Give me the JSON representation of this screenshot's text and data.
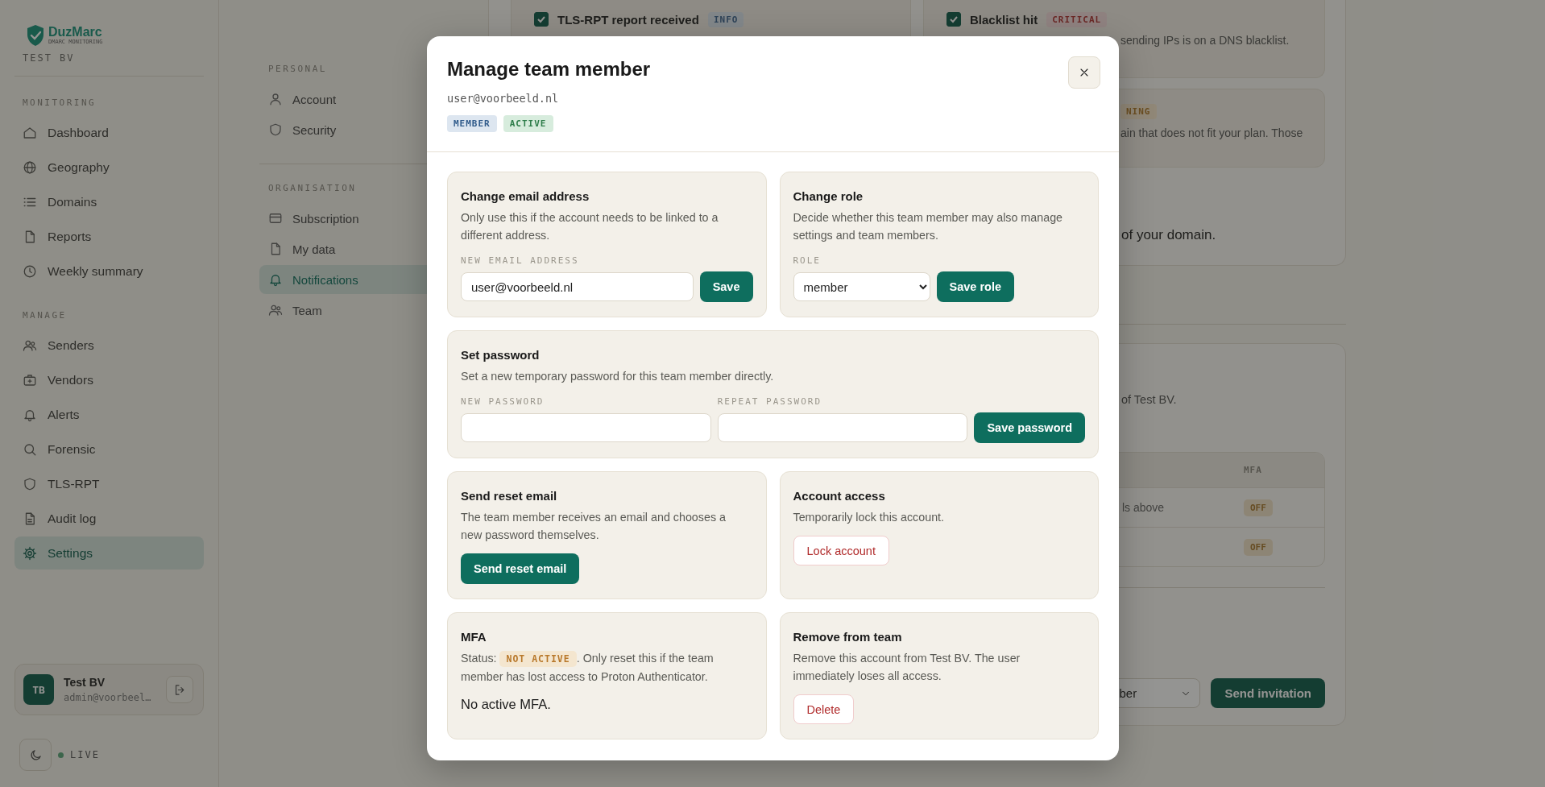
{
  "sidebar": {
    "logo": {
      "name": "DuzMarc",
      "tagline": "DMARC MONITORING"
    },
    "organisation": "TEST BV",
    "sections": [
      {
        "title": "MONITORING",
        "items": [
          {
            "label": "Dashboard",
            "selected": false
          },
          {
            "label": "Geography",
            "selected": false
          },
          {
            "label": "Domains",
            "selected": false
          },
          {
            "label": "Reports",
            "selected": false
          },
          {
            "label": "Weekly summary",
            "selected": false
          }
        ]
      },
      {
        "title": "MANAGE",
        "items": [
          {
            "label": "Senders",
            "selected": false
          },
          {
            "label": "Vendors",
            "selected": false
          },
          {
            "label": "Alerts",
            "selected": false
          },
          {
            "label": "Forensic",
            "selected": false
          },
          {
            "label": "TLS-RPT",
            "selected": false
          },
          {
            "label": "Audit log",
            "selected": false
          },
          {
            "label": "Settings",
            "selected": true
          }
        ]
      }
    ],
    "user": {
      "initials": "TB",
      "name": "Test BV",
      "email": "admin@voorbeel…"
    },
    "status": "LIVE"
  },
  "settings_nav": {
    "sections": [
      {
        "title": "PERSONAL",
        "items": [
          {
            "label": "Account",
            "selected": false
          },
          {
            "label": "Security",
            "selected": false
          }
        ]
      },
      {
        "title": "ORGANISATION",
        "items": [
          {
            "label": "Subscription",
            "selected": false
          },
          {
            "label": "My data",
            "selected": false
          },
          {
            "label": "Notifications",
            "selected": true
          },
          {
            "label": "Team",
            "selected": false
          }
        ]
      }
    ]
  },
  "notifications": {
    "cards": [
      {
        "title": "TLS-RPT report received",
        "checked": true,
        "badge": "INFO",
        "kind": "info"
      },
      {
        "title": "Blacklist hit",
        "checked": true,
        "badge": "CRITICAL",
        "kind": "critical",
        "description": "sending IPs is on a DNS blacklist."
      },
      {
        "badge": "NING",
        "kind": "warning",
        "description": "ain that does not fit your plan. Those"
      }
    ],
    "note": "of your domain."
  },
  "team": {
    "description": "of Test BV.",
    "table": {
      "columns": [
        {
          "label": "MFA"
        }
      ],
      "rows": [
        {
          "column_1": "ls above",
          "mfa": "OFF"
        },
        {
          "mfa": "OFF"
        }
      ]
    },
    "invite": {
      "role": "ber",
      "button": "Send invitation"
    }
  },
  "modal": {
    "title": "Manage team member",
    "email": "user@voorbeeld.nl",
    "badges": [
      {
        "label": "MEMBER",
        "kind": "role"
      },
      {
        "label": "ACTIVE",
        "kind": "status"
      }
    ],
    "sections": [
      {
        "kind": "field",
        "title": "Change email address",
        "description": "Only use this if the account needs to be linked to a different address.",
        "field_label": "NEW EMAIL ADDRESS",
        "value": "user@voorbeeld.nl",
        "button": "Save"
      },
      {
        "kind": "select",
        "title": "Change role",
        "description": "Decide whether this team member may also manage settings and team members.",
        "field_label": "ROLE",
        "value": "member",
        "button": "Save role"
      },
      {
        "kind": "password",
        "title": "Set password",
        "description": "Set a new temporary password for this team member directly.",
        "fields": [
          {
            "label": "NEW PASSWORD"
          },
          {
            "label": "REPEAT PASSWORD"
          }
        ],
        "button": "Save password"
      },
      {
        "kind": "action",
        "title": "Send reset email",
        "description": "The team member receives an email and chooses a new password themselves.",
        "button": {
          "label": "Send reset email",
          "kind": "primary"
        }
      },
      {
        "kind": "action",
        "title": "Account access",
        "description": "Temporarily lock this account.",
        "button": {
          "label": "Lock account",
          "kind": "danger"
        }
      },
      {
        "kind": "status",
        "title": "MFA",
        "status_label": "Status:",
        "status": "NOT ACTIVE",
        "note": ". Only reset this if the team member has lost access to Proton Authenticator.",
        "message": "No active MFA."
      },
      {
        "kind": "action",
        "title": "Remove from team",
        "description": "Remove this account from Test BV. The user immediately loses all access.",
        "button": {
          "label": "Delete",
          "kind": "danger"
        }
      }
    ]
  }
}
